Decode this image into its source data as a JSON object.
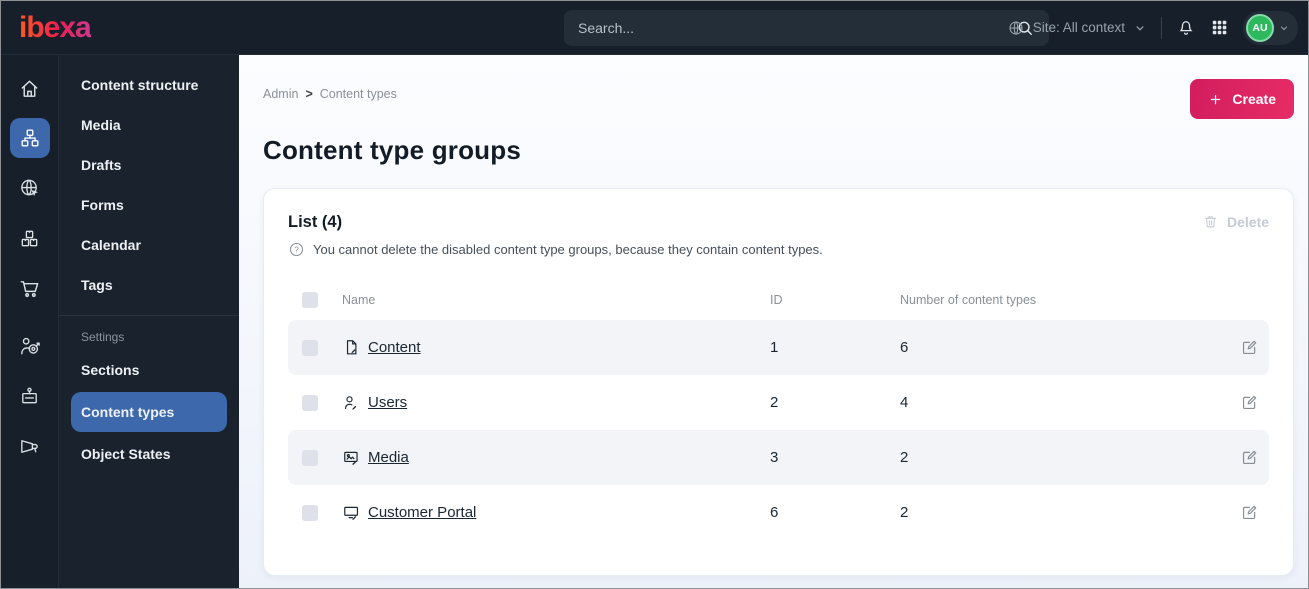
{
  "colors": {
    "topbar_bg": "#161f2a",
    "sidebar_bg": "#19222d",
    "accent_blue": "#3d68ac",
    "create_gradient_start": "#d21d5d",
    "create_gradient_end": "#e62c66",
    "avatar_green": "#2eb85c",
    "page_bg_bottom": "#edf1fa",
    "row_alt_bg": "#f2f4f7",
    "text_dark": "#131c26",
    "text_muted": "#8a9097"
  },
  "topbar": {
    "logo_text": "ibexa",
    "search_placeholder": "Search...",
    "site_label": "Site: All context",
    "avatar_initials": "AU",
    "icons": [
      "search-icon",
      "globe-icon",
      "chevron-down-icon",
      "bell-icon",
      "app-grid-icon"
    ]
  },
  "icon_rail": {
    "icons": [
      "home-icon",
      "content-structure-icon",
      "site-globe-icon",
      "products-icon",
      "commerce-cart-icon",
      "personalization-icon",
      "admin-badge-icon",
      "campaign-megaphone-icon"
    ],
    "active_icon": "content-structure-icon"
  },
  "sidebar": {
    "items": [
      "Content structure",
      "Media",
      "Drafts",
      "Forms",
      "Calendar",
      "Tags"
    ],
    "section_label": "Settings",
    "section_items": [
      "Sections",
      "Content types",
      "Object States"
    ],
    "active_item": "Content types"
  },
  "main": {
    "breadcrumb": {
      "items": [
        "Admin",
        "Content types"
      ],
      "separator": ">"
    },
    "create_button": "Create",
    "page_title": "Content type groups",
    "card": {
      "list_title": "List (4)",
      "info_text": "You cannot delete the disabled content type groups, because they contain content types.",
      "delete_button": "Delete",
      "table": {
        "headers": [
          "Name",
          "ID",
          "Number of content types"
        ],
        "rows": [
          {
            "icon": "file-icon",
            "name": "Content",
            "id": "1",
            "content_types": "6"
          },
          {
            "icon": "user-icon",
            "name": "Users",
            "id": "2",
            "content_types": "4"
          },
          {
            "icon": "image-icon",
            "name": "Media",
            "id": "3",
            "content_types": "2"
          },
          {
            "icon": "monitor-icon",
            "name": "Customer Portal",
            "id": "6",
            "content_types": "2"
          }
        ]
      }
    }
  }
}
